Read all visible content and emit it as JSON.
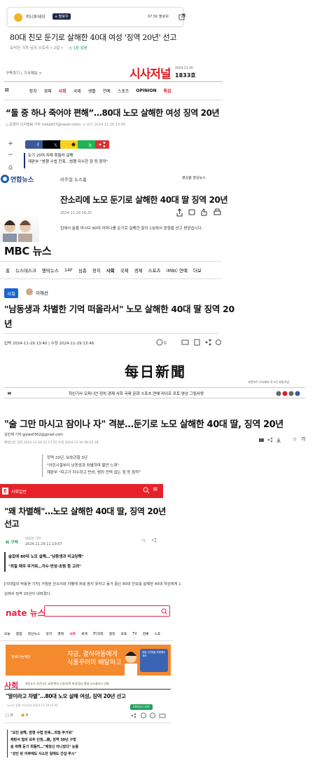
{
  "money_today": {
    "outlet": "머니투데이",
    "subscribe": "+ 팔로우",
    "subscribers": "97.5K 팔로워",
    "title": "80대 친모 둔기로 살해한 40대 여성 '징역 20년' 선고",
    "meta": "오석진 기자 님의 스토리 • 2일 •",
    "read_time": "1분 읽음"
  },
  "sisa_journal": {
    "top_links": "구독하기 | 기사제보 >",
    "logo": "시사저널",
    "date": "2024.11.30",
    "issue": "1833호",
    "nav": [
      "정치",
      "경제",
      "사회",
      "국제",
      "생활",
      "연예",
      "스포츠",
      "OPINION",
      "특집"
    ],
    "active_nav": "사회",
    "title": "“둘 중 하나 죽어야 편해”…80대 노모 살해한 여성 징역 20년",
    "byline": "△ 문경아 디지털팀 기자 (mka927@naver.com)",
    "date_line": "⊙ 승인 2024.11.29 13:05",
    "related": [
      "둔기 20여 차례 휘둘러 살해",
      "재판부 “범행 수법 잔혹…범행 자수한 점 등 참작”"
    ],
    "side_plus": "+",
    "side_minus": "−",
    "share_colors": [
      "#3b5998",
      "#000000",
      "#f7d21b",
      "#21b256",
      "#d93336"
    ]
  },
  "yonhap": {
    "logo": "연합뉴스",
    "category": "비주얼 뉴스홈",
    "links": "영상홈    영상뉴스",
    "title": "잔소리에 노모 둔기로 살해한 40대 딸 징역 20년",
    "date": "2024-11-29 16:25",
    "lead": "집에서 술을 마시다 80대 어머니를 둔기로 살해한 딸이 1심에서 중형을 선고 받았습니다."
  },
  "mbc": {
    "logo": "MBC 뉴스",
    "nav": [
      "홈",
      "뉴스데스크",
      "엠빅뉴스",
      "14F",
      "심층",
      "정치",
      "사회",
      "국제",
      "경제",
      "스포츠",
      "iMBC 연예",
      "더보"
    ],
    "active_nav": "사회",
    "badge": "사회",
    "reporter": "이해선",
    "title": "\"남동생과 차별한 기억 떠올라서\" 노모 살해한 40대 딸 징역 20년",
    "date": "입력 2024-11-29 13:40 | 수정 2024-11-29 13:46",
    "comments": "0"
  },
  "mainichi": {
    "masthead": "每日新聞",
    "util": "지면보기   기사제보   로그인   회원가입",
    "nav": "최신기사 오피니언 정치 경제 사회 국제 문화 스포츠 연예 라이프 포토·영상 그림사랑",
    "title": "\"술 그만 마시고 잠이나 자\" 격분…둔기로 노모 살해한 40대 딸, 징역 20년",
    "email": "심민재 기자 gjsws0302@gmail.com",
    "date": "매일신문 입력 2024-11-29 22:17:25 수정 2024-11-30 08:52:18",
    "font_label": "가",
    "related": [
      "징역 20년, 보호관찰 3년",
      "\"어린시절부터 남동생과 차별하며 불안 느껴\"",
      "재판부 \"피고가 자수하고 반성, 범죄 전력 없는 점 등 참작\""
    ]
  },
  "edaily": {
    "section": "사회일반",
    "title": "\"왜 차별해\"…노모 살해한 40대 딸, 징역 20년 선고",
    "n_label": "N 구독",
    "reporter": "박동현 기자",
    "date": "2024.11.29 11:10:07",
    "headlines": [
      "술집에 80대 노모 살해…\"남동생과 비교당해\"",
      "\"죄질 매우 무거워…자수·반성·초범 등 고려\""
    ],
    "body": "[이데일리 박동현 기자] 거침된 잔소리와 차별에 화를 참지 못하고 동거 중인 80대 친모를 살해한 40대 여성에게 1심에서 징역 20년이 내려졌다."
  },
  "nate": {
    "logo": "nate 뉴스",
    "nav": [
      "오늘",
      "종합",
      "최신뉴스",
      "정치",
      "경제",
      "사회",
      "세계",
      "IT/과학",
      "랭킹",
      "포토",
      "TV",
      "연예",
      "스포"
    ],
    "active_nav": "사회",
    "ad_logo": "영베나눔재단",
    "ad_text_1": "지금, 결식아동에게",
    "ad_text_2": "식품꾸러미 배달하고",
    "ad_badge": "매일 5천원을 후원해주세요",
    "section": "사회",
    "subnav": "최신뉴스  사건사고  교육/복지  노동/지역  여성/정신  환경  뉴스플러스  인물",
    "title": "\"말이라고 차별\"…80대 노모 살해 여성, 징역 20년 선고",
    "ai_badge": "AI에디터 요약",
    "byline": "뉴시스 원본    기사전송 2024-11-29 16:40",
    "reaction": "0",
    "headlines": [
      "\"모친 살해, 범행 수법 잔혹…죄질 무거워\"",
      "재판서 혐의 모두 인정…檢, 징역 30년 구형",
      "술 취해 둔기 휘둘러…\"제정신 아니었다\" 눈물",
      "\"성인 된 이후에도 사소한 일에도 간섭·무시\""
    ]
  }
}
